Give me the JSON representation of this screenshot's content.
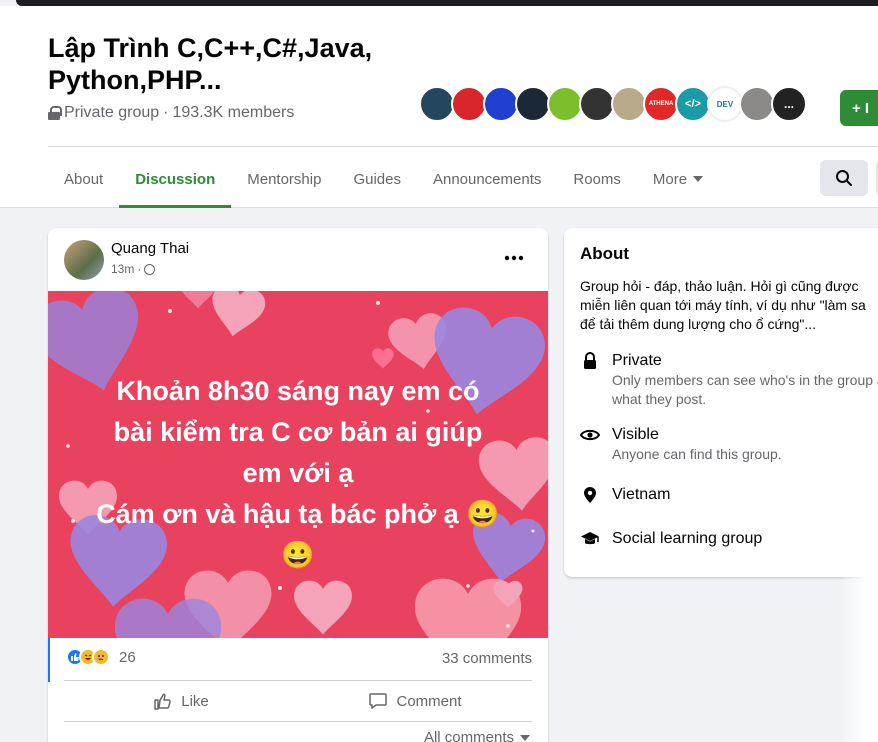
{
  "group": {
    "title": "Lập Trình C,C++,C#,Java, Python,PHP...",
    "privacy": "Private group",
    "separator": "·",
    "members": "193.3K members",
    "join_label": "+ I"
  },
  "tabs": [
    {
      "label": "About"
    },
    {
      "label": "Discussion"
    },
    {
      "label": "Mentorship"
    },
    {
      "label": "Guides"
    },
    {
      "label": "Announcements"
    },
    {
      "label": "Rooms"
    },
    {
      "label": "More"
    }
  ],
  "post": {
    "author": "Quang Thai",
    "time": "13m",
    "text_lines": [
      "Khoản 8h30 sáng nay em có",
      "bài kiểm tra C cơ bản ai giúp",
      "em với ạ",
      "Cám ơn và hậu tạ bác phở ạ 😀",
      "😀"
    ],
    "reaction_count": "26",
    "comment_count": "33 comments",
    "like_label": "Like",
    "comment_label": "Comment",
    "all_comments_label": "All comments"
  },
  "about": {
    "title": "About",
    "description": "Group hỏi - đáp, thảo luận. Hỏi gì cũng được\nmiễn liên quan tới máy tính, ví dụ như \"làm sa\nđể tải thêm dung lượng cho ổ cứng\"...",
    "items": [
      {
        "title": "Private",
        "subtitle": "Only members can see who's in the group and what they post.",
        "icon": "lock-icon"
      },
      {
        "title": "Visible",
        "subtitle": "Anyone can find this group.",
        "icon": "eye-icon"
      },
      {
        "title": "Vietnam",
        "subtitle": "",
        "icon": "location-pin-icon"
      },
      {
        "title": "Social learning group",
        "subtitle": "",
        "icon": "graduation-cap-icon"
      }
    ]
  },
  "member_avatar_labels": [
    "",
    "",
    "",
    "",
    "",
    "",
    "",
    "ATHENA",
    "</>",
    "DEV",
    "",
    "..."
  ],
  "colors": {
    "brand_green": "#2e8b36",
    "post_bg": "#e8425e",
    "page_bg": "#f0f2f5"
  }
}
